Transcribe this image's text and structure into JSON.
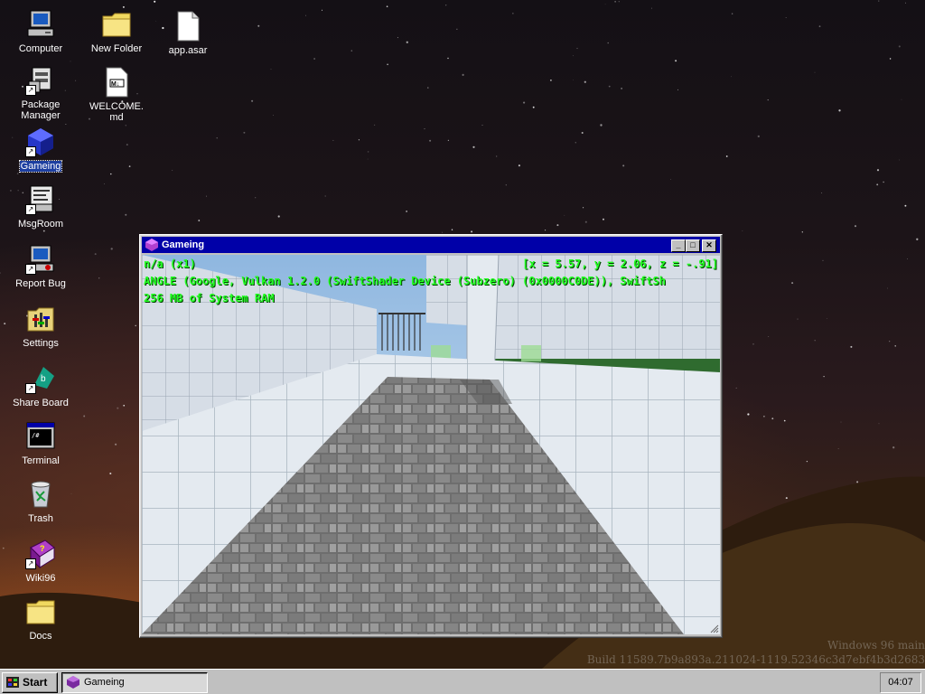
{
  "desktop": {
    "icons": [
      {
        "label": "Computer",
        "icon": "computer-icon",
        "selected": false
      },
      {
        "label": "Package Manager",
        "icon": "package-manager-icon",
        "selected": false
      },
      {
        "label": "Gameing",
        "icon": "gameing-icon",
        "selected": true
      },
      {
        "label": "MsgRoom",
        "icon": "msgroom-icon",
        "selected": false
      },
      {
        "label": "Report Bug",
        "icon": "report-bug-icon",
        "selected": false
      },
      {
        "label": "Settings",
        "icon": "settings-icon",
        "selected": false
      },
      {
        "label": "Share Board",
        "icon": "share-board-icon",
        "selected": false
      },
      {
        "label": "Terminal",
        "icon": "terminal-icon",
        "selected": false
      },
      {
        "label": "Trash",
        "icon": "trash-icon",
        "selected": false
      },
      {
        "label": "Wiki96",
        "icon": "wiki-book-icon",
        "selected": false
      },
      {
        "label": "Docs",
        "icon": "folder-icon",
        "selected": false
      },
      {
        "label": "New Folder",
        "icon": "folder-icon",
        "selected": false
      },
      {
        "label": "WELCOME.md",
        "icon": "markdown-file-icon",
        "selected": false
      },
      {
        "label": "app.asar",
        "icon": "file-icon",
        "selected": false
      }
    ]
  },
  "window": {
    "title": "Gameing",
    "icon": "gameing-icon",
    "buttons": {
      "minimize": "_",
      "maximize": "□",
      "close": "✕"
    },
    "hud": {
      "fps": "n/a (x1)",
      "coords": "[x = 5.57, y = 2.06, z = -.91]",
      "renderer": "ANGLE (Google, Vulkan 1.2.0 (SwiftShader Device (Subzero) (0x0000C0DE)), SwiftSh",
      "memory": "256 MB of System RAM"
    }
  },
  "watermark": {
    "line1": "Windows 96 main",
    "line2": "Build 11589.7b9a893a.211024-1119.52346c3d7ebf4b3d2683"
  },
  "taskbar": {
    "start_label": "Start",
    "task_label": "Gameing",
    "clock": "04:07"
  },
  "colors": {
    "titlebar": "#0000a8",
    "hud_text": "#22ff22",
    "taskbar": "#c0c0c0",
    "selection": "#1d3fa0"
  }
}
